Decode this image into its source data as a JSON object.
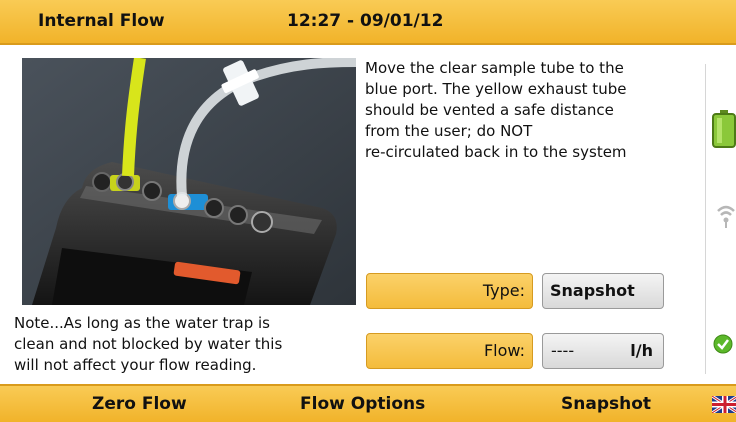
{
  "header": {
    "title": "Internal Flow",
    "clock": "12:27 - 09/01/12"
  },
  "instructions": "Move the clear sample tube to the\nblue port. The yellow exhaust tube\nshould be vented a safe distance\nfrom the user; do NOT\nre-circulated back in to the system",
  "note": "Note...As long as the water trap is\nclean and not blocked by water this\nwill not affect your flow reading.",
  "fields": {
    "type_label": "Type:",
    "type_value": "Snapshot",
    "flow_label": "Flow:",
    "flow_value": "----",
    "flow_unit": "l/h"
  },
  "status": {
    "battery_icon": "battery-full-icon",
    "wireless_icon": "wireless-signal-icon",
    "ok_icon": "check-circle-icon"
  },
  "softkeys": {
    "left": "Zero Flow",
    "center": "Flow Options",
    "right": "Snapshot"
  },
  "colors": {
    "bar": "#f4bc3c",
    "ok": "#5cb82a"
  }
}
